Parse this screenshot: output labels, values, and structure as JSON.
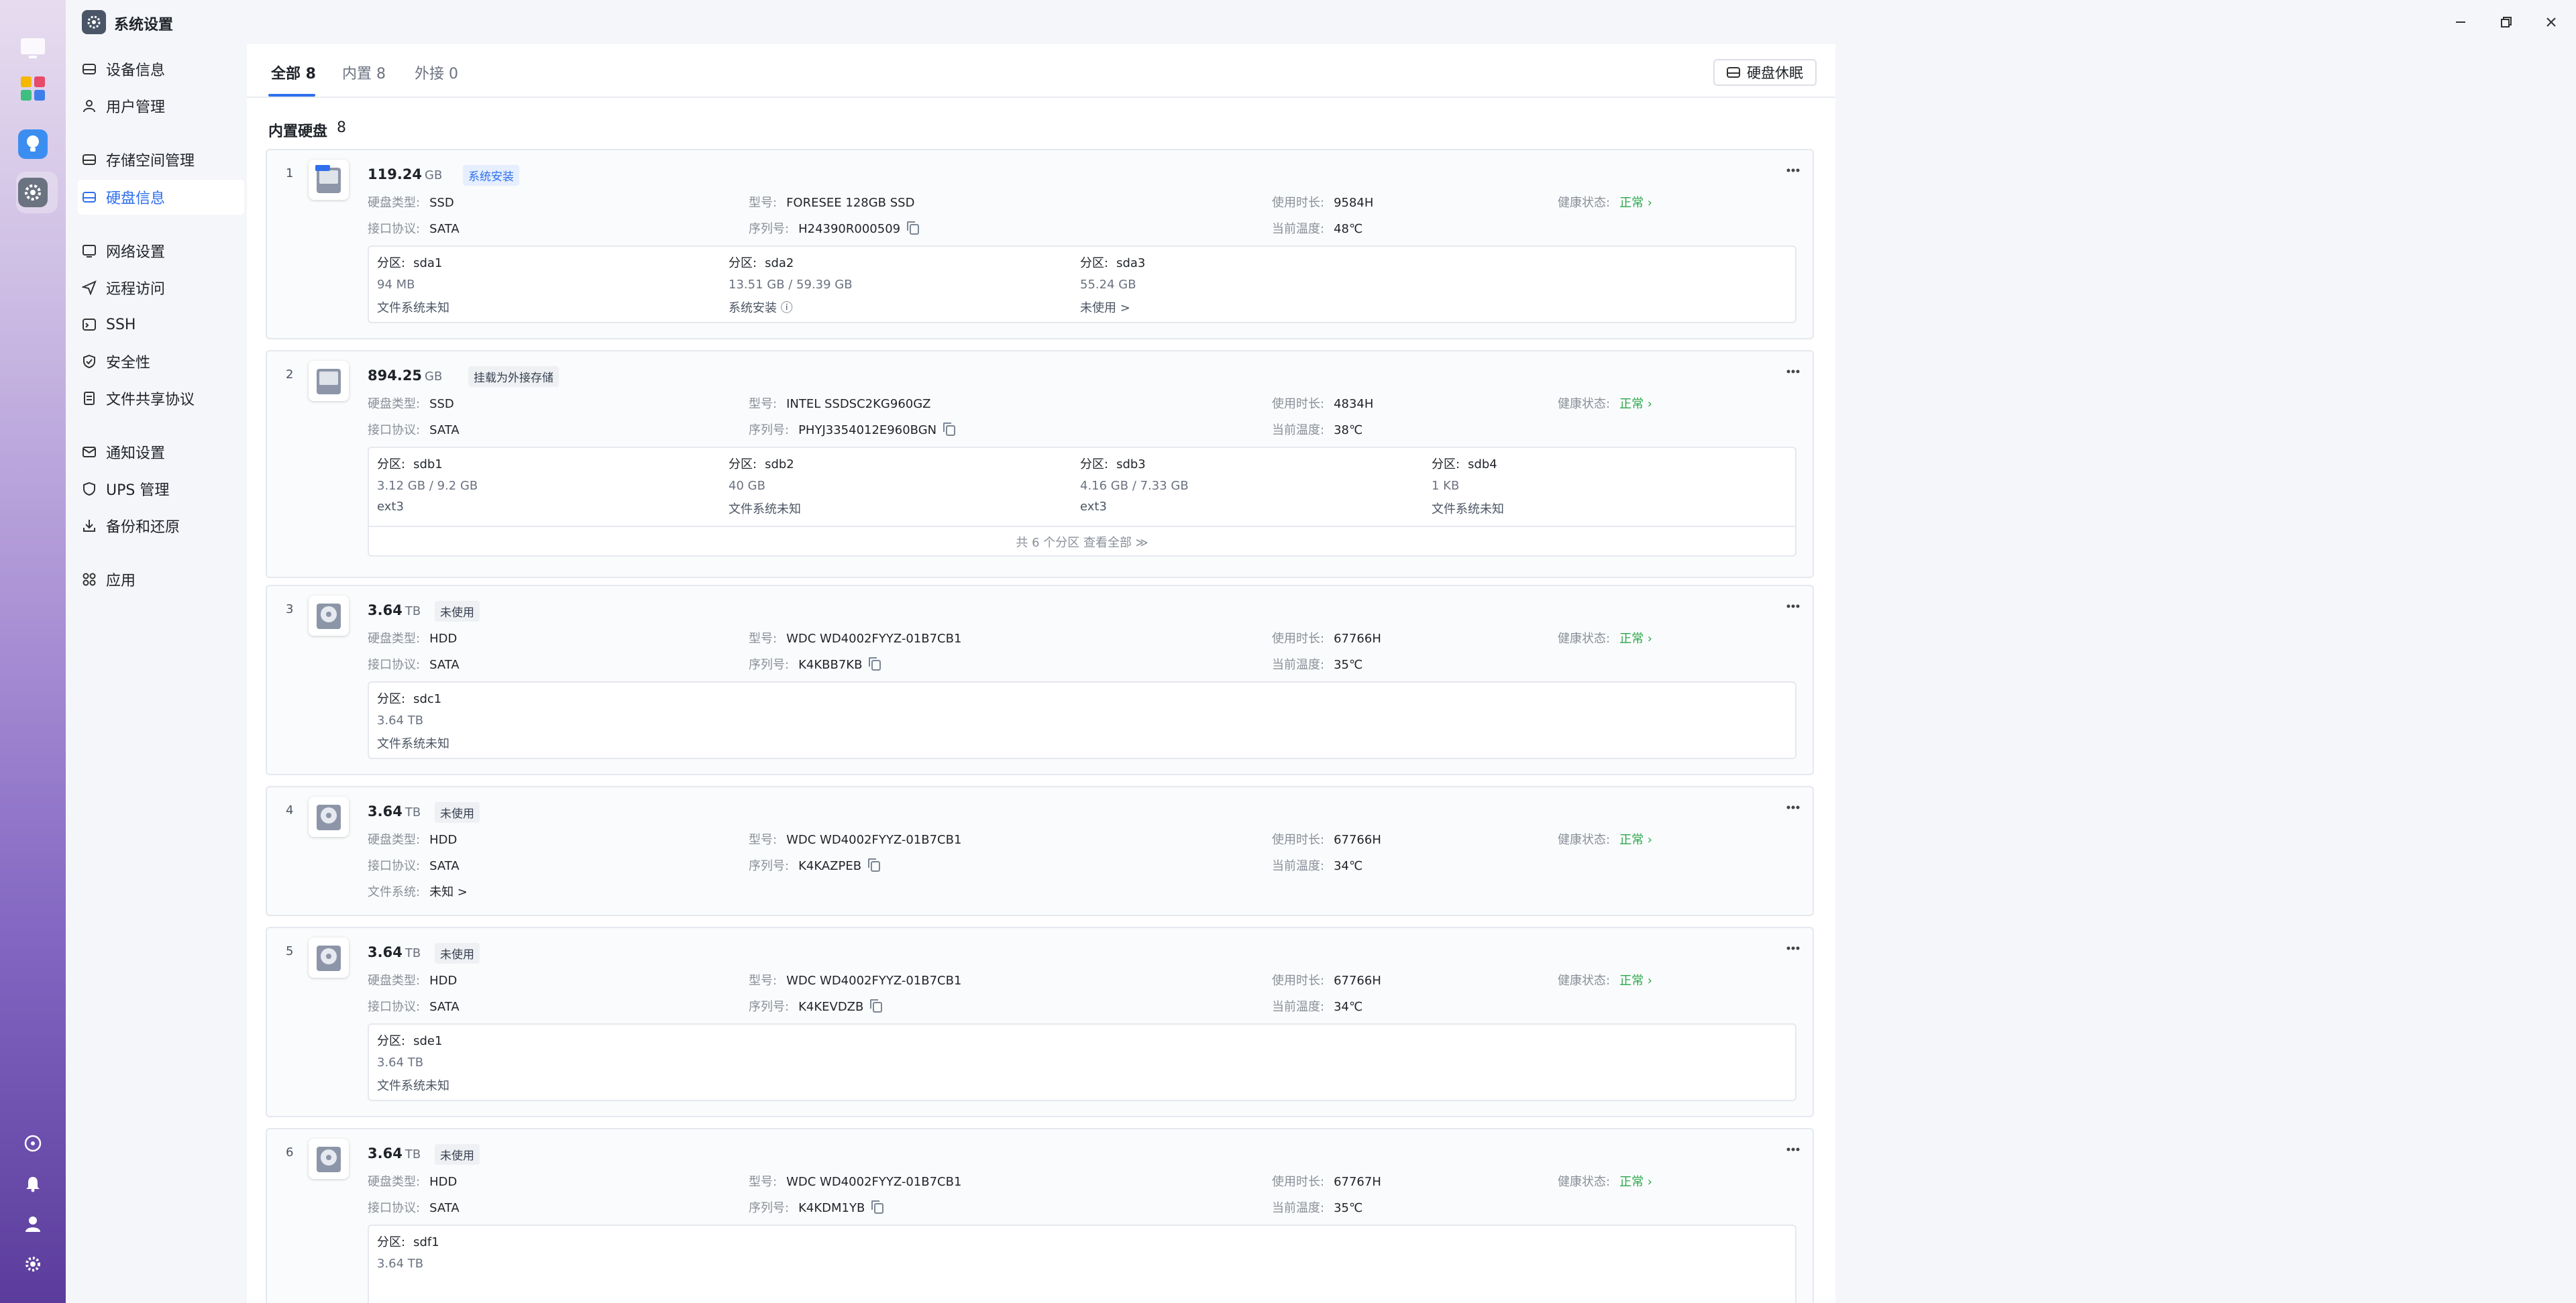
{
  "window": {
    "title": "系统设置"
  },
  "sidebar": {
    "items": [
      {
        "label": "设备信息"
      },
      {
        "label": "用户管理"
      },
      {
        "label": "存储空间管理"
      },
      {
        "label": "硬盘信息"
      },
      {
        "label": "网络设置"
      },
      {
        "label": "远程访问"
      },
      {
        "label": "SSH"
      },
      {
        "label": "安全性"
      },
      {
        "label": "文件共享协议"
      },
      {
        "label": "通知设置"
      },
      {
        "label": "UPS 管理"
      },
      {
        "label": "备份和还原"
      },
      {
        "label": "应用"
      }
    ]
  },
  "tabs": [
    {
      "label": "全部 8"
    },
    {
      "label": "内置 8"
    },
    {
      "label": "外接 0"
    }
  ],
  "sleep_button": "硬盘休眠",
  "section": {
    "title": "内置硬盘",
    "count": "8"
  },
  "labels": {
    "disk_type": "硬盘类型:",
    "interface": "接口协议:",
    "model": "型号:",
    "serial": "序列号:",
    "usage": "使用时长:",
    "temp": "当前温度:",
    "health": "健康状态:",
    "partition": "分区:",
    "filesystem": "文件系统:"
  },
  "disks": [
    {
      "index": "1",
      "size": "119.24",
      "unit": "GB",
      "badge": "系统安装",
      "badge_color": "blue",
      "type": "SSD",
      "interface": "SATA",
      "model": "FORESEE 128GB SSD",
      "serial": "H24390R000509",
      "usage": "9584H",
      "temp": "48℃",
      "health": "正常 ›",
      "partitions": [
        {
          "name": "sda1",
          "size": "94 MB",
          "fs": "文件系统未知"
        },
        {
          "name": "sda2",
          "size": "13.51 GB / 59.39 GB",
          "fs": "系统安装 ⓘ"
        },
        {
          "name": "sda3",
          "size": "55.24 GB",
          "fs": "未使用 >"
        }
      ]
    },
    {
      "index": "2",
      "size": "894.25",
      "unit": "GB",
      "badge": "挂载为外接存储",
      "badge_color": "gray",
      "type": "SSD",
      "interface": "SATA",
      "model": "INTEL SSDSC2KG960GZ",
      "serial": "PHYJ3354012E960BGN",
      "usage": "4834H",
      "temp": "38℃",
      "health": "正常 ›",
      "partitions": [
        {
          "name": "sdb1",
          "size": "3.12 GB / 9.2 GB",
          "fs": "ext3"
        },
        {
          "name": "sdb2",
          "size": "40 GB",
          "fs": "文件系统未知"
        },
        {
          "name": "sdb3",
          "size": "4.16 GB / 7.33 GB",
          "fs": "ext3"
        },
        {
          "name": "sdb4",
          "size": "1 KB",
          "fs": "文件系统未知"
        }
      ],
      "partitions_more": "共 6 个分区 查看全部 ≫"
    },
    {
      "index": "3",
      "size": "3.64",
      "unit": "TB",
      "badge": "未使用",
      "badge_color": "gray",
      "type": "HDD",
      "interface": "SATA",
      "model": "WDC WD4002FYYZ-01B7CB1",
      "serial": "K4KBB7KB",
      "usage": "67766H",
      "temp": "35℃",
      "health": "正常 ›",
      "partitions": [
        {
          "name": "sdc1",
          "size": "3.64 TB",
          "fs": "文件系统未知"
        }
      ]
    },
    {
      "index": "4",
      "size": "3.64",
      "unit": "TB",
      "badge": "未使用",
      "badge_color": "gray",
      "type": "HDD",
      "interface": "SATA",
      "model": "WDC WD4002FYYZ-01B7CB1",
      "serial": "K4KAZPEB",
      "usage": "67766H",
      "temp": "34℃",
      "health": "正常 ›",
      "filesystem": "未知 >"
    },
    {
      "index": "5",
      "size": "3.64",
      "unit": "TB",
      "badge": "未使用",
      "badge_color": "gray",
      "type": "HDD",
      "interface": "SATA",
      "model": "WDC WD4002FYYZ-01B7CB1",
      "serial": "K4KEVDZB",
      "usage": "67766H",
      "temp": "34℃",
      "health": "正常 ›",
      "partitions": [
        {
          "name": "sde1",
          "size": "3.64 TB",
          "fs": "文件系统未知"
        }
      ]
    },
    {
      "index": "6",
      "size": "3.64",
      "unit": "TB",
      "badge": "未使用",
      "badge_color": "gray",
      "type": "HDD",
      "interface": "SATA",
      "model": "WDC WD4002FYYZ-01B7CB1",
      "serial": "K4KDM1YB",
      "usage": "67767H",
      "temp": "35℃",
      "health": "正常 ›",
      "partitions": [
        {
          "name": "sdf1",
          "size": "3.64 TB",
          "fs": ""
        }
      ]
    }
  ],
  "colors": {
    "accent": "#2f6fed",
    "ok": "#2ba84a"
  }
}
